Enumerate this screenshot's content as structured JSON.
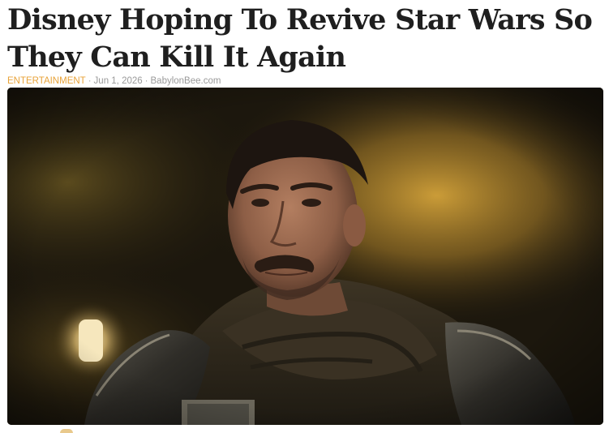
{
  "article": {
    "headline": "Disney Hoping To Revive Star Wars So They Can Kill It Again",
    "category": "ENTERTAINMENT",
    "separator": "·",
    "date": "Jun 1, 2026",
    "source": "BabylonBee.com"
  },
  "hero_image": {
    "subject": "man-in-dark-cloak-and-armor",
    "palette": {
      "background": "#1c170d",
      "warm_light": "#c7972f",
      "lamp": "#f4e4b8",
      "armor": "#3a3832",
      "skin": "#9a6a52"
    }
  },
  "colors": {
    "headline": "#1f1f1f",
    "category": "#e8a33a",
    "meta": "#9a9a9a"
  }
}
